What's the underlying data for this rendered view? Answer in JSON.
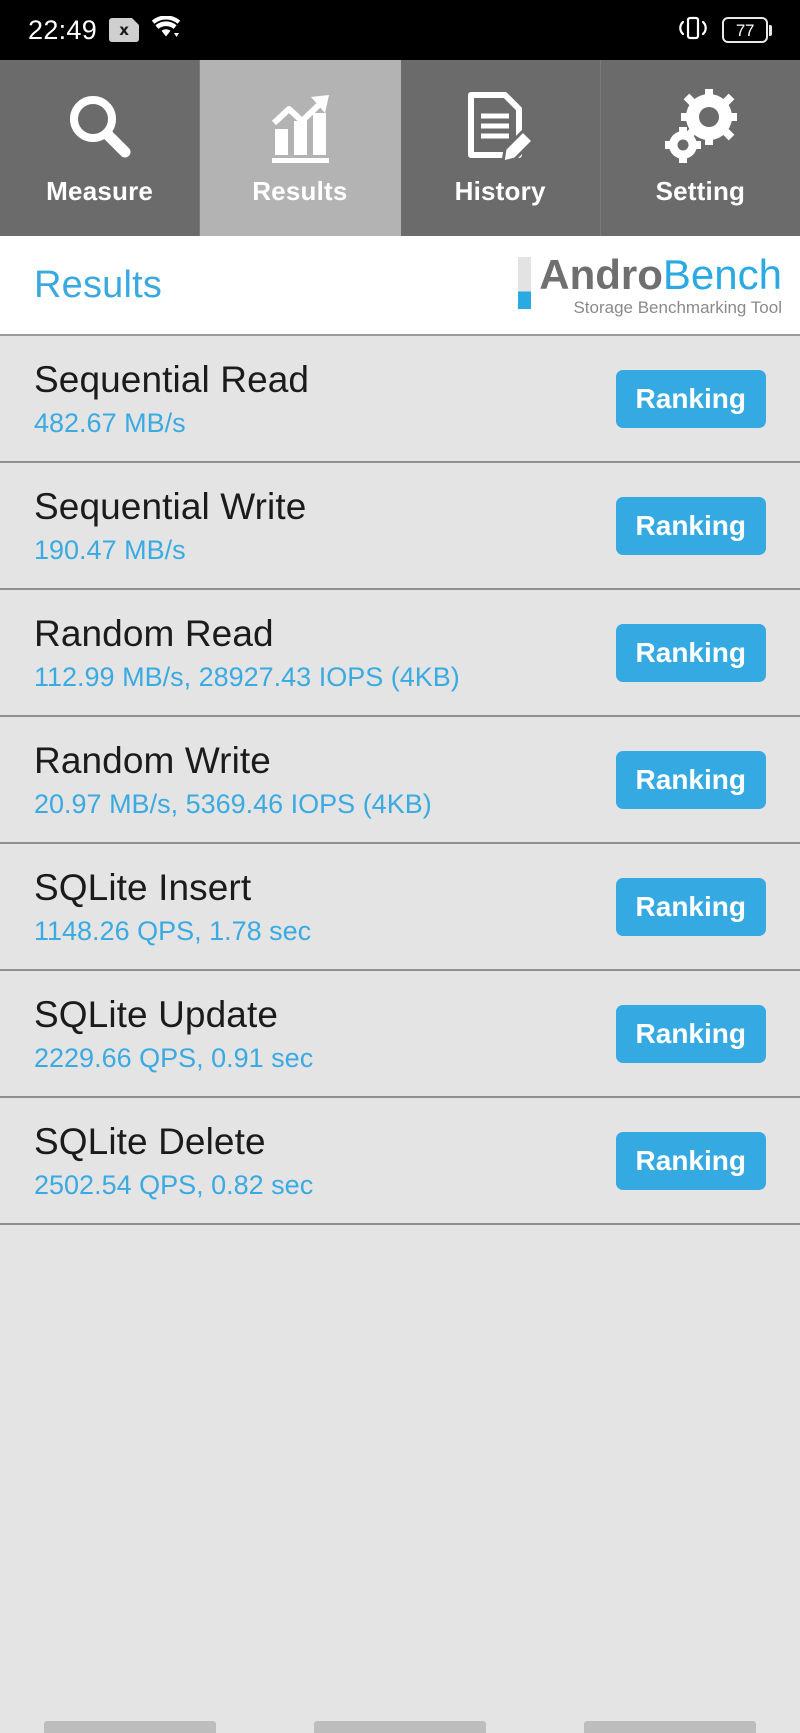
{
  "status_bar": {
    "time": "22:49",
    "sd_badge": "x",
    "icons": [
      "sdcard-off-icon",
      "wifi-icon",
      "vibrate-icon"
    ],
    "battery_level": "77"
  },
  "tabs": [
    {
      "label": "Measure",
      "icon": "magnifier-icon",
      "active": false
    },
    {
      "label": "Results",
      "icon": "bar-chart-icon",
      "active": true
    },
    {
      "label": "History",
      "icon": "document-pencil-icon",
      "active": false
    },
    {
      "label": "Setting",
      "icon": "gears-icon",
      "active": false
    }
  ],
  "header": {
    "page_title": "Results",
    "logo_primary": "Andro",
    "logo_secondary": "Bench",
    "logo_tagline": "Storage Benchmarking Tool"
  },
  "results": [
    {
      "title": "Sequential Read",
      "value": "482.67 MB/s",
      "button": "Ranking"
    },
    {
      "title": "Sequential Write",
      "value": "190.47 MB/s",
      "button": "Ranking"
    },
    {
      "title": "Random Read",
      "value": "112.99 MB/s, 28927.43 IOPS (4KB)",
      "button": "Ranking"
    },
    {
      "title": "Random Write",
      "value": "20.97 MB/s, 5369.46 IOPS (4KB)",
      "button": "Ranking"
    },
    {
      "title": "SQLite Insert",
      "value": "1148.26 QPS, 1.78 sec",
      "button": "Ranking"
    },
    {
      "title": "SQLite Update",
      "value": "2229.66 QPS, 0.91 sec",
      "button": "Ranking"
    },
    {
      "title": "SQLite Delete",
      "value": "2502.54 QPS, 0.82 sec",
      "button": "Ranking"
    }
  ],
  "nav_bar": {
    "items": [
      "nav-back",
      "nav-home",
      "nav-recents"
    ]
  },
  "colors": {
    "accent_blue": "#35a9e2",
    "logo_gray": "#6f6f6f",
    "tab_inactive": "#6b6b6b",
    "tab_active": "#b3b3b3",
    "list_bg": "#e4e4e4"
  }
}
